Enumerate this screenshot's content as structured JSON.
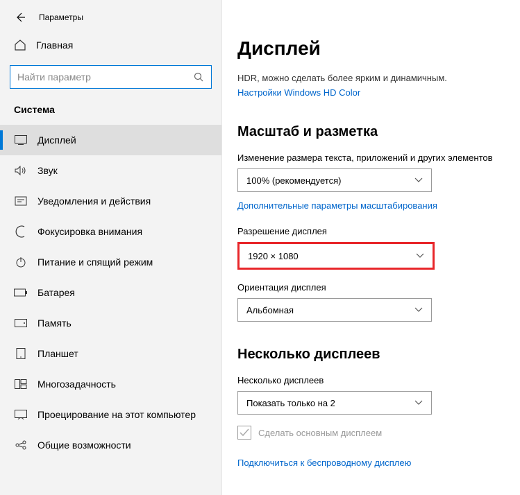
{
  "app_title": "Параметры",
  "home_label": "Главная",
  "search_placeholder": "Найти параметр",
  "section_title": "Система",
  "nav": [
    {
      "label": "Дисплей"
    },
    {
      "label": "Звук"
    },
    {
      "label": "Уведомления и действия"
    },
    {
      "label": "Фокусировка внимания"
    },
    {
      "label": "Питание и спящий режим"
    },
    {
      "label": "Батарея"
    },
    {
      "label": "Память"
    },
    {
      "label": "Планшет"
    },
    {
      "label": "Многозадачность"
    },
    {
      "label": "Проецирование на этот компьютер"
    },
    {
      "label": "Общие возможности"
    }
  ],
  "page_title": "Дисплей",
  "hdr_text": "HDR, можно сделать более ярким и динамичным.",
  "hdr_link": "Настройки Windows HD Color",
  "scale_section": "Масштаб и разметка",
  "scale_label": "Изменение размера текста, приложений и других элементов",
  "scale_value": "100% (рекомендуется)",
  "scale_link": "Дополнительные параметры масштабирования",
  "resolution_label": "Разрешение дисплея",
  "resolution_value": "1920 × 1080",
  "orientation_label": "Ориентация дисплея",
  "orientation_value": "Альбомная",
  "multi_section": "Несколько дисплеев",
  "multi_label": "Несколько дисплеев",
  "multi_value": "Показать только на 2",
  "make_primary": "Сделать основным дисплеем",
  "wireless_link": "Подключиться к беспроводному дисплею"
}
